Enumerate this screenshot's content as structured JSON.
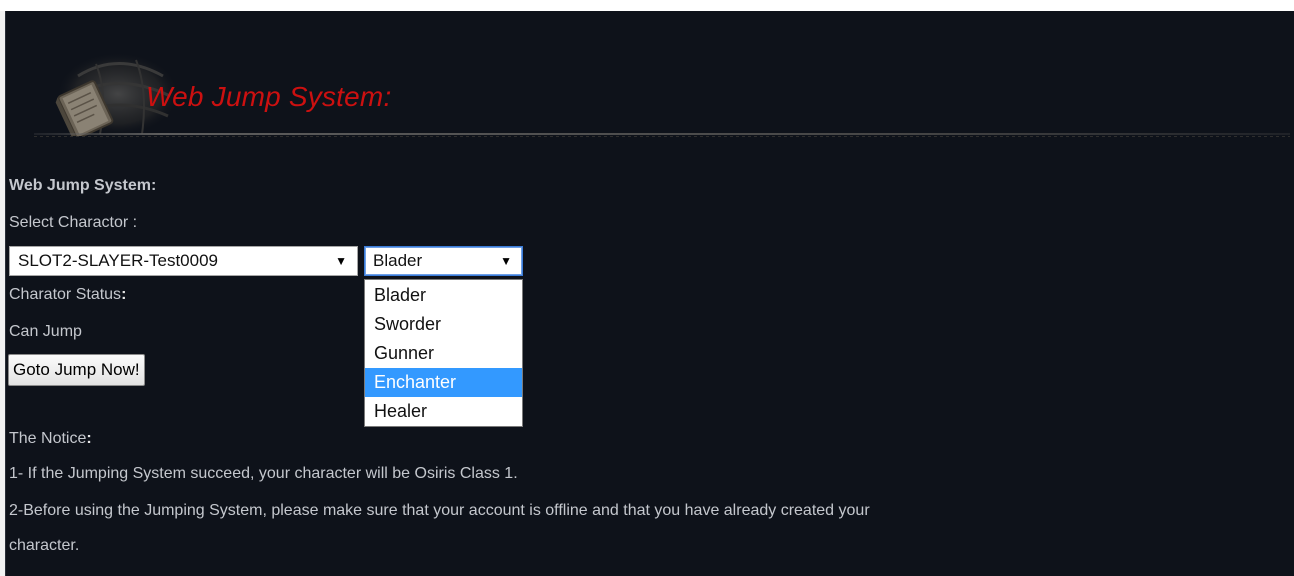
{
  "header": {
    "title": "Web Jump System:"
  },
  "section": {
    "heading": "Web Jump System:"
  },
  "character_select": {
    "label": "Select Charactor :",
    "selected": "SLOT2-SLAYER-Test0009"
  },
  "class_select": {
    "selected": "Blader",
    "options": [
      "Blader",
      "Sworder",
      "Gunner",
      "Enchanter",
      "Healer"
    ],
    "highlighted": "Enchanter"
  },
  "status": {
    "label": "Charator Status",
    "colon": ":",
    "value": "Can Jump"
  },
  "jump_button": {
    "label": "Goto Jump Now!"
  },
  "notice": {
    "label": "The Notice",
    "colon": ":",
    "items": [
      "1- If the Jumping System succeed, your character will be Osiris Class 1.",
      "2-Before using the Jumping System, please make sure that your account is offline and that you have already created your",
      "character."
    ]
  },
  "colors": {
    "background": "#0e121a",
    "title_red": "#cc1010",
    "text": "#c4c7cd",
    "highlight": "#3399ff"
  },
  "icons": {
    "emblem": "book-emblem-icon",
    "dropdown_arrow": "dropdown-arrow-icon"
  }
}
